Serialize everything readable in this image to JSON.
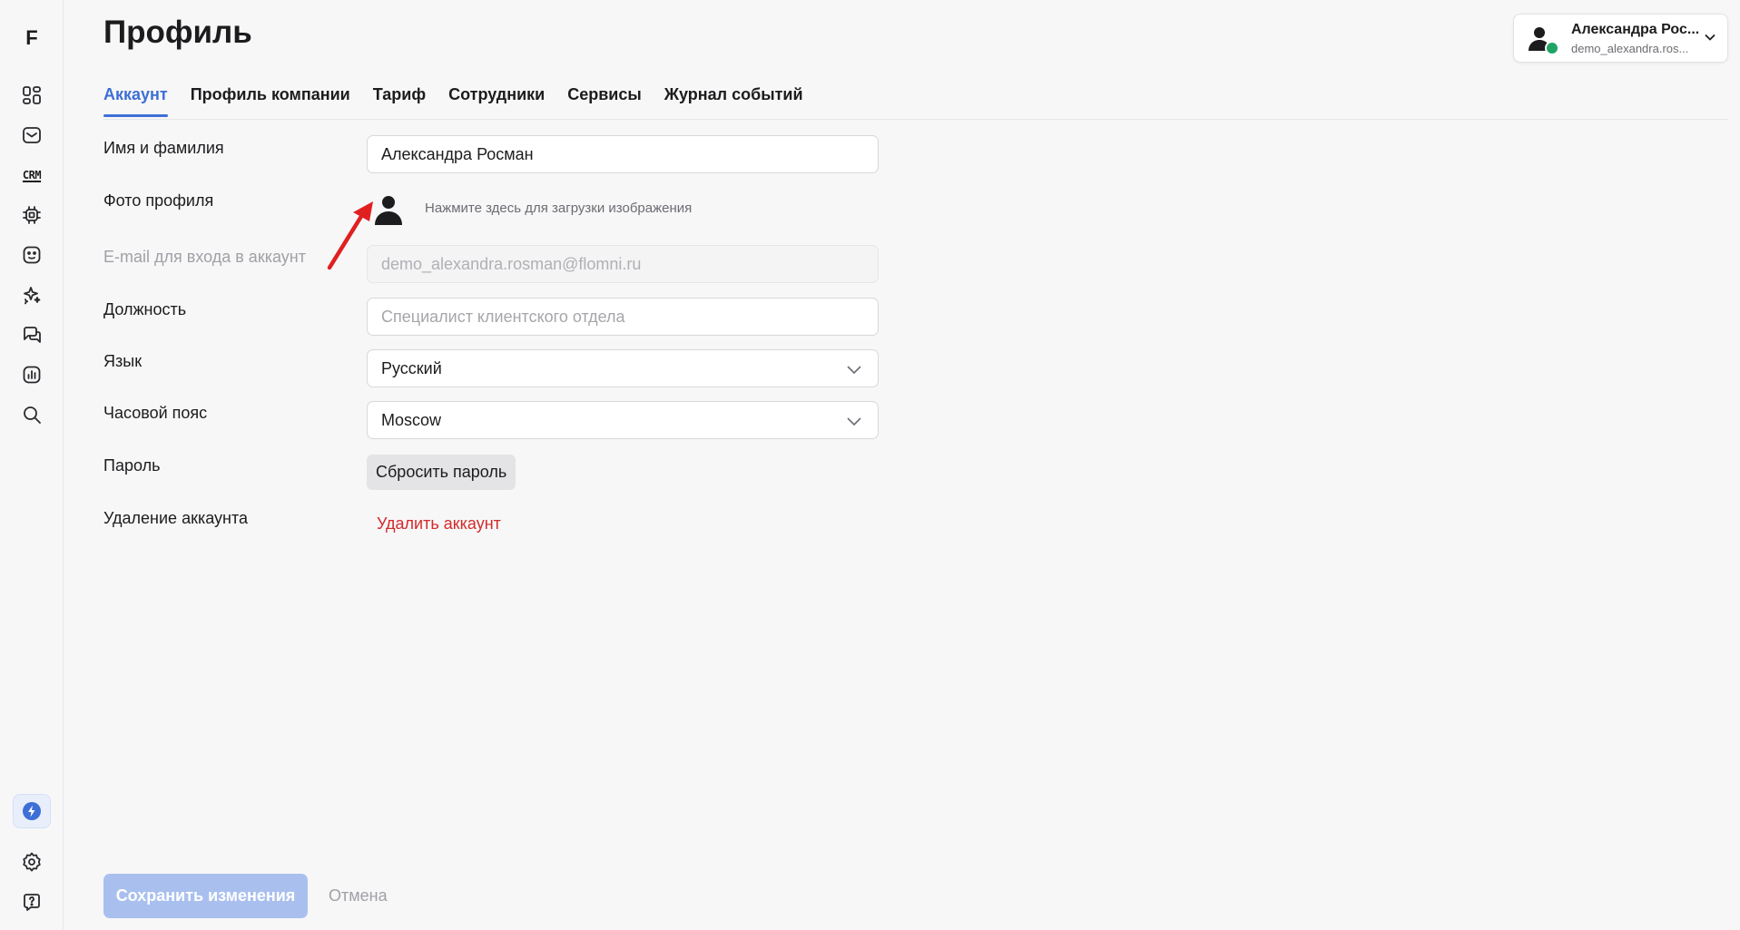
{
  "app": {
    "logo": "F"
  },
  "sidebar": {
    "items": [
      {
        "name": "dashboard-icon"
      },
      {
        "name": "inbox-icon"
      },
      {
        "name": "crm-icon",
        "label": "CRM"
      },
      {
        "name": "chip-icon"
      },
      {
        "name": "bot-icon"
      },
      {
        "name": "sparkle-icon"
      },
      {
        "name": "chats-icon"
      },
      {
        "name": "analytics-icon"
      },
      {
        "name": "search-icon"
      }
    ],
    "bottom": [
      {
        "name": "bolt-icon"
      },
      {
        "name": "settings-icon"
      },
      {
        "name": "help-icon"
      }
    ]
  },
  "header": {
    "title": "Профиль"
  },
  "user": {
    "name": "Александра Рос...",
    "email": "demo_alexandra.ros...",
    "status_color": "#1fa463"
  },
  "tabs": [
    {
      "label": "Аккаунт",
      "active": true
    },
    {
      "label": "Профиль компании"
    },
    {
      "label": "Тариф"
    },
    {
      "label": "Сотрудники"
    },
    {
      "label": "Сервисы"
    },
    {
      "label": "Журнал событий"
    }
  ],
  "form": {
    "name_label": "Имя и фамилия",
    "name_value": "Александра Росман",
    "photo_label": "Фото профиля",
    "photo_hint": "Нажмите здесь для загрузки изображения",
    "email_label": "E-mail для входа в аккаунт",
    "email_value": "demo_alexandra.rosman@flomni.ru",
    "position_label": "Должность",
    "position_placeholder": "Специалист клиентского отдела",
    "language_label": "Язык",
    "language_value": "Русский",
    "timezone_label": "Часовой пояс",
    "timezone_value": "Moscow",
    "password_label": "Пароль",
    "reset_password": "Сбросить пароль",
    "delete_label": "Удаление аккаунта",
    "delete_link": "Удалить аккаунт"
  },
  "footer": {
    "save": "Сохранить изменения",
    "cancel": "Отмена"
  },
  "colors": {
    "accent": "#3d6fd6",
    "danger": "#d32a2a",
    "annotation_arrow": "#e02020"
  }
}
